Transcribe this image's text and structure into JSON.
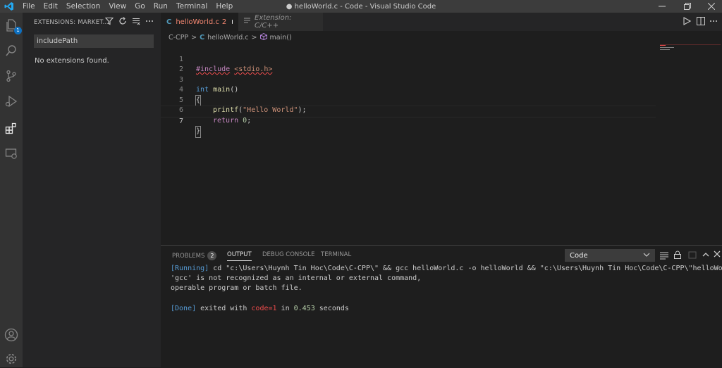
{
  "window": {
    "title": "● helloWorld.c - Code - Visual Studio Code",
    "menu": [
      "File",
      "Edit",
      "Selection",
      "View",
      "Go",
      "Run",
      "Terminal",
      "Help"
    ]
  },
  "activity_bar": {
    "explorer_badge": "1",
    "icons": [
      "files-icon",
      "search-icon",
      "source-control-icon",
      "run-debug-icon",
      "extensions-icon",
      "remote-explorer-icon",
      "account-icon",
      "settings-gear-icon"
    ]
  },
  "sidebar": {
    "title": "EXTENSIONS: MARKET...",
    "search_value": "includePath",
    "message": "No extensions found."
  },
  "tabs": [
    {
      "label": "helloWorld.c",
      "problems": "2",
      "modified": true,
      "active": true
    },
    {
      "label": "Extension: C/C++",
      "active": false
    }
  ],
  "breadcrumb": [
    "C-CPP",
    "helloWorld.c",
    "main()"
  ],
  "editor": {
    "lines": [
      "1",
      "2",
      "3",
      "4",
      "5",
      "6",
      "7"
    ],
    "code": {
      "l1_directive": "#include",
      "l1_header": "<stdio.h>",
      "l3_type": "int",
      "l3_fn": "main",
      "l3_rest": "()",
      "l4": "{",
      "l5_fn": "printf",
      "l5_open": "(",
      "l5_str": "\"Hello World\"",
      "l5_close": ");",
      "l6_kw": "return",
      "l6_num": "0",
      "l6_end": ";",
      "l7": "}"
    }
  },
  "panel": {
    "tabs": {
      "problems": "PROBLEMS",
      "problems_count": "2",
      "output": "OUTPUT",
      "debug_console": "DEBUG CONSOLE",
      "terminal": "TERMINAL"
    },
    "channel": "Code",
    "output": {
      "running_tag": "[Running]",
      "running_cmd": " cd \"c:\\Users\\Huynh Tin Hoc\\Code\\C-CPP\\\" && gcc helloWorld.c -o helloWorld && \"c:\\Users\\Huynh Tin Hoc\\Code\\C-CPP\\\"helloWorld",
      "error_line1": "'gcc' is not recognized as an internal or external command,",
      "error_line2": "operable program or batch file.",
      "done_tag": "[Done]",
      "done_text1": " exited with ",
      "done_code": "code=1",
      "done_text2": " in ",
      "done_time": "0.453",
      "done_text3": " seconds"
    }
  },
  "colors": {
    "accent": "#0e70c0",
    "keyword": "#569cd6",
    "string": "#ce9178",
    "function": "#dcdcaa",
    "error": "#f14c4c"
  }
}
